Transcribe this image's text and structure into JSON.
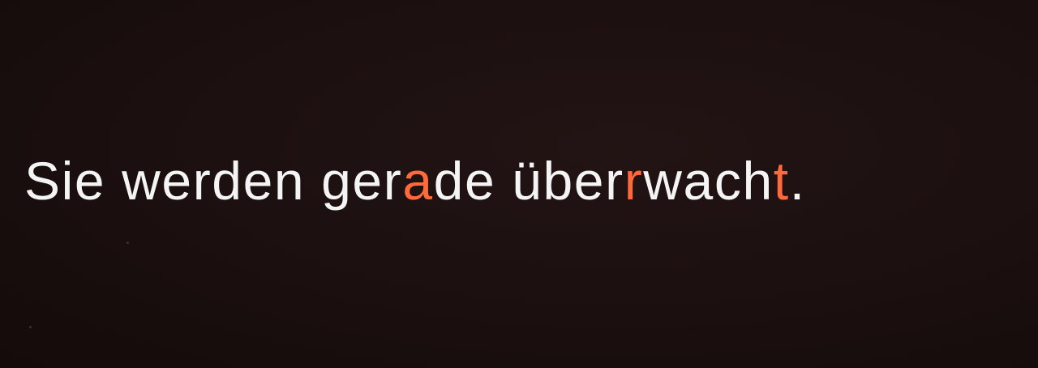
{
  "sign": {
    "segments": [
      {
        "text": "Sie werden ger",
        "accent": false
      },
      {
        "text": "a",
        "accent": true
      },
      {
        "text": "de über",
        "accent": false
      },
      {
        "text": "r",
        "accent": true
      },
      {
        "text": "wach",
        "accent": false
      },
      {
        "text": "t",
        "accent": true
      },
      {
        "text": ".",
        "accent": false
      }
    ]
  },
  "colors": {
    "background": "#1a0f0f",
    "text": "#f4f4f4",
    "accent": "#ff6a3a"
  }
}
